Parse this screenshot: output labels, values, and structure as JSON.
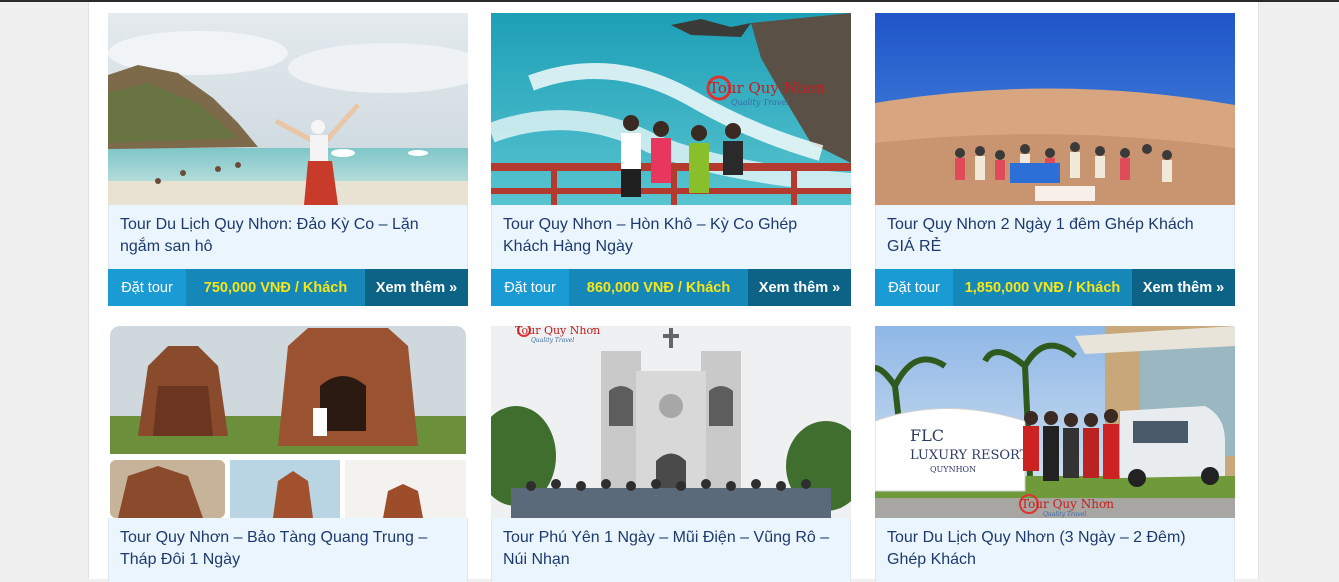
{
  "tours": [
    {
      "title": "Tour Du Lịch Quy Nhơn: Đảo Kỳ Co – Lặn ngắm san hô",
      "book_label": "Đặt tour",
      "price": "750,000 VNĐ / Khách",
      "more_label": "Xem thêm »"
    },
    {
      "title": "Tour Quy Nhơn – Hòn Khô – Kỳ Co Ghép Khách Hàng Ngày",
      "book_label": "Đặt tour",
      "price": "860,000 VNĐ / Khách",
      "more_label": "Xem thêm »"
    },
    {
      "title": "Tour Quy Nhơn 2 Ngày 1 đêm Ghép Khách GIÁ RẺ",
      "book_label": "Đặt tour",
      "price": "1,850,000 VNĐ / Khách",
      "more_label": "Xem thêm »"
    },
    {
      "title": "Tour Quy Nhơn – Bảo Tàng Quang Trung – Tháp Đôi 1 Ngày"
    },
    {
      "title": "Tour Phú Yên 1 Ngày – Mũi Điện – Vũng Rô – Núi Nhạn"
    },
    {
      "title": "Tour Du Lịch Quy Nhơn (3 Ngày – 2 Đêm) Ghép Khách"
    }
  ],
  "watermark": {
    "brand": "Tour Quy Nhơn",
    "tagline": "Quality Travel"
  },
  "signs": {
    "resort_line1": "FLC",
    "resort_line2": "LUXURY RESORT",
    "resort_line3": "QUYNHON"
  },
  "colors": {
    "book_bg": "#1a9bd4",
    "price_bg": "#1587b9",
    "price_text": "#f5e61a",
    "more_bg": "#0d6386",
    "title_bg": "#eaf5fd",
    "title_text": "#1e3a6e"
  }
}
